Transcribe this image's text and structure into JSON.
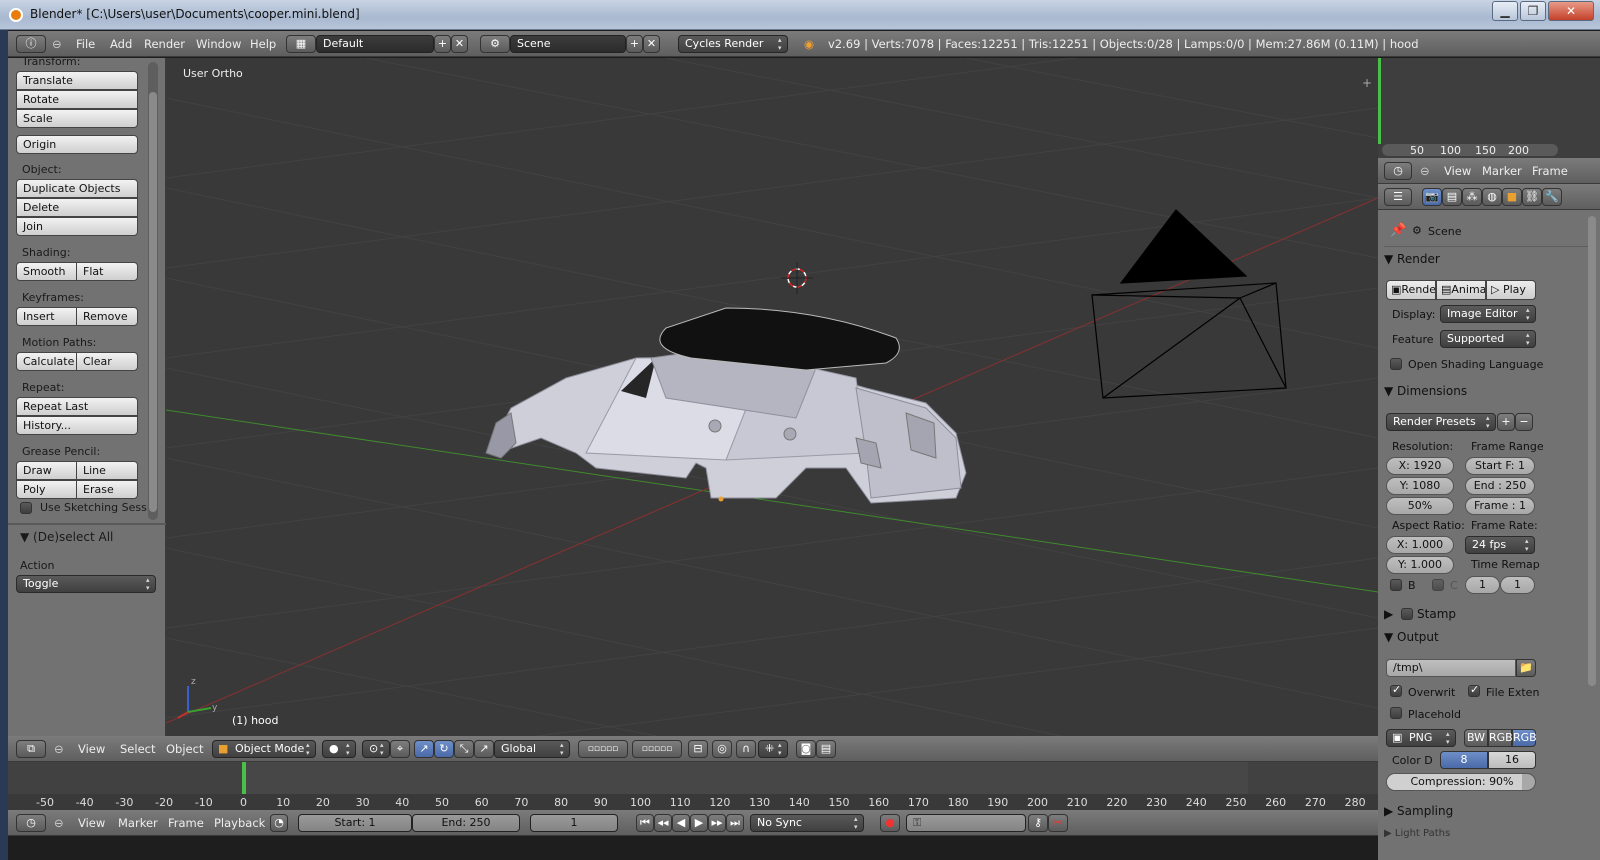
{
  "window": {
    "title": "Blender* [C:\\Users\\user\\Documents\\cooper.mini.blend]",
    "buttons": [
      "▁",
      "❐",
      "✕"
    ]
  },
  "info_header": {
    "menus": [
      "File",
      "Add",
      "Render",
      "Window",
      "Help"
    ],
    "layout": "Default",
    "scene": "Scene",
    "engine": "Cycles Render",
    "stats": "v2.69 | Verts:7078 | Faces:12251 | Tris:12251 | Objects:0/28 | Lamps:0/0 | Mem:27.86M (0.11M) | hood"
  },
  "toolshelf": {
    "transform_label": "Transform:",
    "translate": "Translate",
    "rotate": "Rotate",
    "scale": "Scale",
    "origin": "Origin",
    "object_label": "Object:",
    "duplicate": "Duplicate Objects",
    "delete": "Delete",
    "join": "Join",
    "shading_label": "Shading:",
    "smooth": "Smooth",
    "flat": "Flat",
    "keyframes_label": "Keyframes:",
    "insert": "Insert",
    "remove": "Remove",
    "motion_label": "Motion Paths:",
    "calculate": "Calculate",
    "clear": "Clear",
    "repeat_label": "Repeat:",
    "repeat_last": "Repeat Last",
    "history": "History...",
    "grease_label": "Grease Pencil:",
    "draw": "Draw",
    "line": "Line",
    "poly": "Poly",
    "erase": "Erase",
    "sketching": "Use Sketching Sessi",
    "operator_title": "(De)select All",
    "action_label": "Action",
    "action_value": "Toggle"
  },
  "viewport": {
    "view_name": "User Ortho",
    "object_info": "(1) hood"
  },
  "view3d_header": {
    "menus": [
      "View",
      "Select",
      "Object"
    ],
    "mode": "Object Mode",
    "orientation": "Global"
  },
  "timeline_mini": {
    "ticks": [
      "50",
      "100",
      "150",
      "200"
    ],
    "menus": [
      "View",
      "Marker",
      "Frame"
    ]
  },
  "timeline": {
    "ticks": [
      "-50",
      "-40",
      "-30",
      "-20",
      "-10",
      "0",
      "10",
      "20",
      "30",
      "40",
      "50",
      "60",
      "70",
      "80",
      "90",
      "100",
      "110",
      "120",
      "130",
      "140",
      "150",
      "160",
      "170",
      "180",
      "190",
      "200",
      "210",
      "220",
      "230",
      "240",
      "250",
      "260",
      "270",
      "280"
    ],
    "current_frame": 0,
    "menus": [
      "View",
      "Marker",
      "Frame",
      "Playback"
    ],
    "start": "Start: 1",
    "end": "End: 250",
    "frame": "1",
    "sync": "No Sync"
  },
  "properties": {
    "context": "Scene",
    "render_header": "Render",
    "render_btn": "Render",
    "anim_btn": "Animation",
    "play_btn": "Play",
    "display_label": "Display:",
    "display_value": "Image Editor",
    "feature_label": "Feature",
    "feature_value": "Supported",
    "osl": "Open Shading Language",
    "dimensions_header": "Dimensions",
    "presets": "Render Presets",
    "resolution_label": "Resolution:",
    "frame_range_label": "Frame Range",
    "res_x": "X: 1920",
    "res_y": "Y: 1080",
    "res_pct": "50%",
    "start_f": "Start F: 1",
    "end_f": "End : 250",
    "frame_step": "Frame : 1",
    "aspect_label": "Aspect Ratio:",
    "framerate_label": "Frame Rate:",
    "aspect_x": "X: 1.000",
    "aspect_y": "Y: 1.000",
    "fps": "24 fps",
    "time_remap": "Time Remap",
    "border_b": "B",
    "border_c": "C",
    "remap_old": "1",
    "remap_new": "1",
    "stamp_header": "Stamp",
    "output_header": "Output",
    "output_path": "/tmp\\",
    "overwrite": "Overwrit",
    "file_ext": "File Exten",
    "placeholder": "Placehold",
    "format": "PNG",
    "bw": "BW",
    "rgb": "RGB",
    "rgba": "RGB",
    "color_depth_label": "Color D",
    "depth_8": "8",
    "depth_16": "16",
    "compression": "Compression: 90%",
    "sampling_header": "Sampling",
    "light_paths_header": "Light Paths"
  },
  "colors": {
    "accent_blue": "#5680c2",
    "viewport_bg": "#393939",
    "panel_bg": "#727272",
    "frame_marker": "#4ac04a"
  }
}
